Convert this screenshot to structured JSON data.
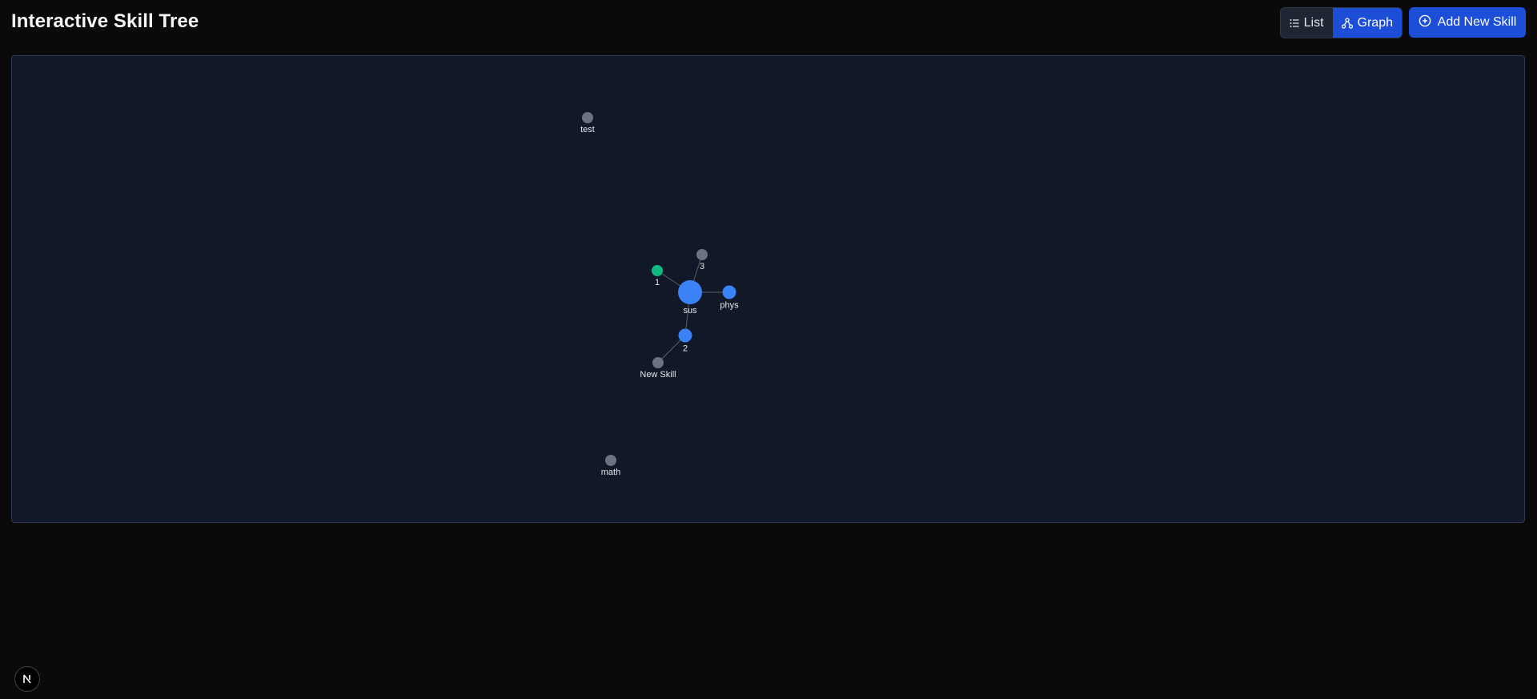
{
  "header": {
    "title": "Interactive Skill Tree",
    "view_toggle": {
      "list_label": "List",
      "graph_label": "Graph",
      "active": "graph"
    },
    "add_button_label": "Add New Skill"
  },
  "graph": {
    "nodes": [
      {
        "id": "test",
        "label": "test",
        "color": "#6b7280",
        "size": "small"
      },
      {
        "id": "3",
        "label": "3",
        "color": "#6b7280",
        "size": "small"
      },
      {
        "id": "1",
        "label": "1",
        "color": "#10b981",
        "size": "small"
      },
      {
        "id": "sus",
        "label": "sus",
        "color": "#3b82f6",
        "size": "large"
      },
      {
        "id": "phys",
        "label": "phys",
        "color": "#3b82f6",
        "size": "medium"
      },
      {
        "id": "2",
        "label": "2",
        "color": "#3b82f6",
        "size": "medium"
      },
      {
        "id": "new-skill",
        "label": "New Skill",
        "color": "#6b7280",
        "size": "small"
      },
      {
        "id": "math",
        "label": "math",
        "color": "#6b7280",
        "size": "small"
      }
    ],
    "edges": [
      {
        "from": "sus",
        "to": "3"
      },
      {
        "from": "sus",
        "to": "1"
      },
      {
        "from": "sus",
        "to": "phys"
      },
      {
        "from": "sus",
        "to": "2"
      },
      {
        "from": "2",
        "to": "new-skill"
      }
    ]
  },
  "icons": {
    "list": "list-icon",
    "graph": "graph-icon",
    "add": "plus-circle-icon",
    "dev_badge": "next-logo-icon"
  }
}
